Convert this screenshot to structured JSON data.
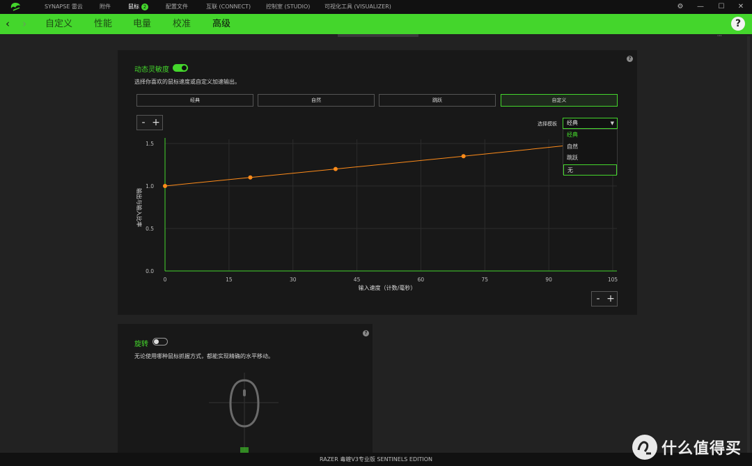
{
  "titlebar": {
    "menu": [
      {
        "label": "SYNAPSE 雷云"
      },
      {
        "label": "附件"
      },
      {
        "label": "鼠标",
        "badge": "2"
      },
      {
        "label": "配置文件"
      },
      {
        "label": "互联 (CONNECT)"
      },
      {
        "label": "控制室 (STUDIO)"
      },
      {
        "label": "可视化工具 (VISUALIZER)"
      }
    ],
    "controls": {
      "settings": "⚙",
      "minimize": "—",
      "maximize": "☐",
      "close": "✕"
    }
  },
  "nav": {
    "tabs": [
      "自定义",
      "性能",
      "电量",
      "校准",
      "高级"
    ],
    "active_tab": "高级",
    "help": "?"
  },
  "sensitivity": {
    "title": "动态灵敏度",
    "enabled": true,
    "description": "选择你喜欢的鼠标速度或自定义加速输出。",
    "presets": [
      "经典",
      "自然",
      "跳跃",
      "自定义"
    ],
    "active_preset": "自定义",
    "minus": "-",
    "plus": "+",
    "template_label": "选择模板",
    "template_value": "经典",
    "template_options": [
      "经典",
      "自然",
      "跳跃",
      "无"
    ]
  },
  "chart_data": {
    "type": "line",
    "xlabel": "输入速度（计数/毫秒）",
    "ylabel": "输出与输入比率",
    "x_ticks": [
      0,
      15,
      30,
      45,
      60,
      75,
      90,
      105
    ],
    "y_ticks": [
      "0.0",
      "0.5",
      "1.0",
      "1.5"
    ],
    "xlim": [
      0,
      105
    ],
    "ylim": [
      0,
      1.5
    ],
    "grid": true,
    "line_color": "#ff8c1a",
    "points": [
      [
        0,
        1.0
      ],
      [
        20,
        1.1
      ],
      [
        40,
        1.2
      ],
      [
        70,
        1.35
      ]
    ],
    "line_end": [
      95,
      1.48
    ]
  },
  "rotation": {
    "title": "旋转",
    "enabled": false,
    "description": "无论使用哪种鼠标抓握方式，都能实现精确的水平移动。"
  },
  "footer": {
    "device": "RAZER 毒蝰V3专业版 SENTINELS EDITION"
  },
  "watermark": {
    "text": "什么值得买"
  },
  "colors": {
    "accent": "#44d62c",
    "curve": "#ff8c1a",
    "panel": "#181818",
    "background": "#222222"
  }
}
